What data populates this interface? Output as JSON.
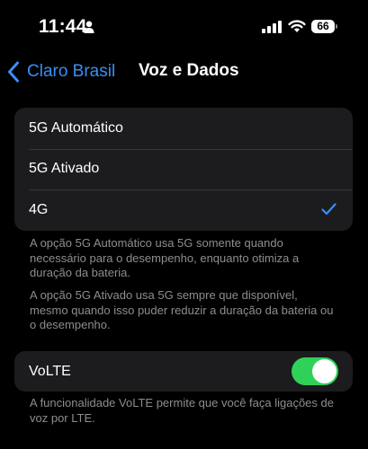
{
  "status_bar": {
    "time": "11:44",
    "battery_level": "66",
    "icons": [
      "person-icon",
      "signal-icon",
      "wifi-icon",
      "battery-icon"
    ]
  },
  "nav": {
    "back_label": "Claro Brasil",
    "title": "Voz e Dados"
  },
  "network_options": {
    "items": [
      {
        "label": "5G Automático",
        "selected": false
      },
      {
        "label": "5G Ativado",
        "selected": false
      },
      {
        "label": "4G",
        "selected": true
      }
    ]
  },
  "notes": {
    "auto_5g": "A opção 5G Automático usa 5G somente quando necessário para o desempenho, enquanto otimiza a duração da bateria.",
    "on_5g": "A opção 5G Ativado usa 5G sempre que disponível, mesmo quando isso puder reduzir a duração da bateria ou o desempenho.",
    "volte": "A funcionalidade VoLTE permite que você faça ligações de voz por LTE."
  },
  "volte": {
    "label": "VoLTE",
    "enabled": true
  },
  "colors": {
    "accent": "#3a8ff5",
    "toggle_on": "#30d158",
    "group_bg": "#1c1c1e",
    "footnote": "#8d8d93"
  }
}
